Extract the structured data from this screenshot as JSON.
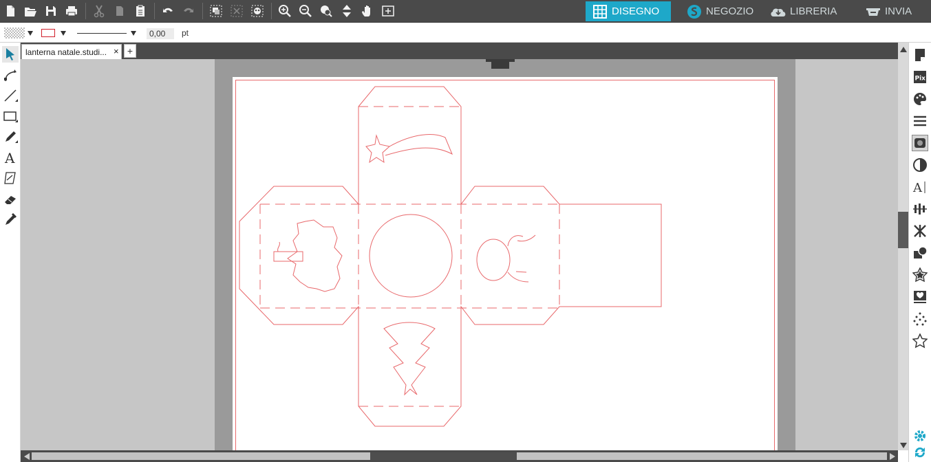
{
  "nav": {
    "tabs": [
      {
        "label": "DISEGNO",
        "icon": "grid-icon",
        "active": true
      },
      {
        "label": "NEGOZIO",
        "icon": "store-icon",
        "active": false
      },
      {
        "label": "LIBRERIA",
        "icon": "cloud-library-icon",
        "active": false
      },
      {
        "label": "INVIA",
        "icon": "cutter-icon",
        "active": false
      }
    ]
  },
  "toolbar": {
    "buttons": [
      "new-document-icon",
      "open-folder-icon",
      "save-icon",
      "print-icon",
      "cut-icon",
      "copy-icon",
      "paste-icon",
      "undo-icon",
      "redo-icon",
      "group-icon",
      "ungroup-icon",
      "compound-path-icon",
      "zoom-in-icon",
      "zoom-out-icon",
      "zoom-selection-icon",
      "move-icon",
      "pan-hand-icon",
      "fit-to-page-icon"
    ]
  },
  "stylebar": {
    "stroke_width": "0,00",
    "stroke_unit": "pt",
    "line_color": "#d01e2a"
  },
  "document": {
    "tab_title": "lanterna natale.studi...",
    "close_label": "×",
    "add_label": "+"
  },
  "colors": {
    "accent": "#1ea8c9",
    "cut_line": "#e8676a",
    "toolbar_bg": "#4a4a4a"
  },
  "left_tools": [
    "select-arrow-icon",
    "edit-points-icon",
    "line-tool-icon",
    "rectangle-tool-icon",
    "pencil-tool-icon",
    "text-tool-icon",
    "knife-tool-icon",
    "eraser-tool-icon",
    "eyedropper-icon"
  ],
  "right_panel": [
    "page-setup-icon",
    "pixscan-icon",
    "fill-color-icon",
    "line-style-icon",
    "image-icon",
    "trace-icon",
    "text-style-icon",
    "align-icon",
    "replicate-icon",
    "modify-icon",
    "offset-icon",
    "design-store-icon",
    "library-icon",
    "dots-icon",
    "favorite-icon",
    "settings-gear-icon",
    "sync-icon"
  ]
}
